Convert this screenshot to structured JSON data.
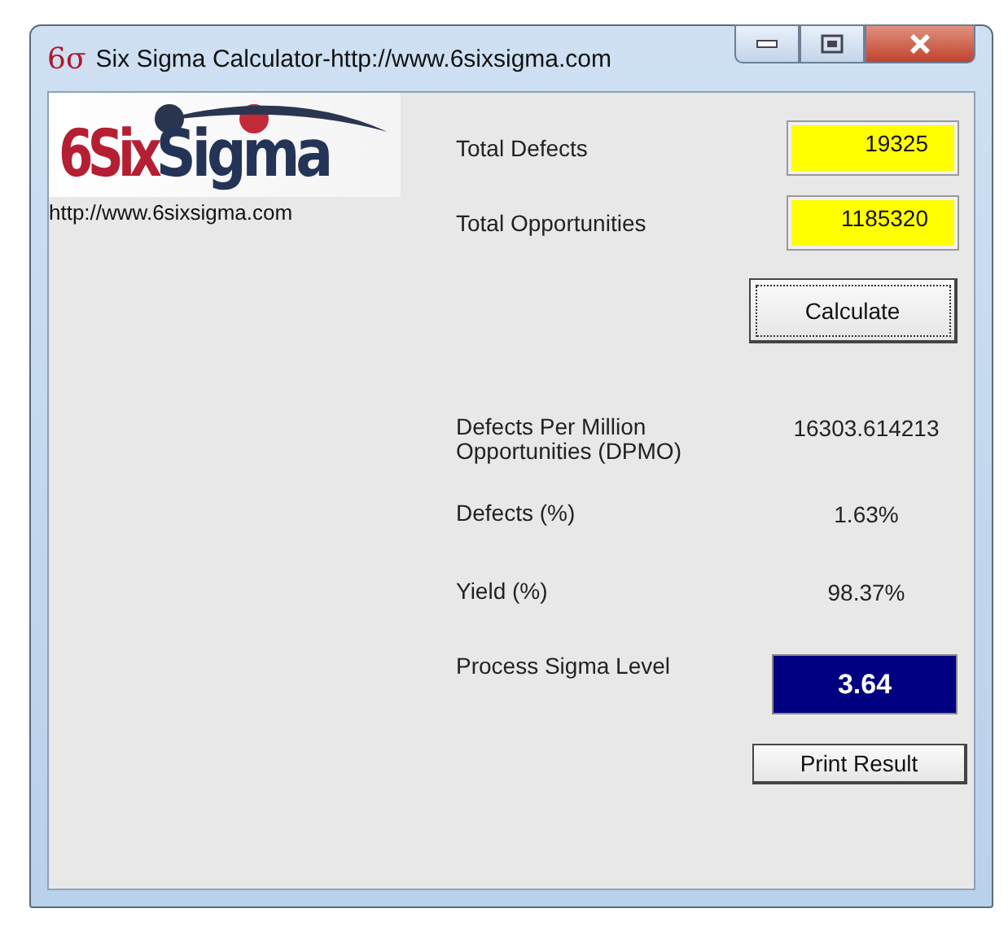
{
  "window": {
    "app_icon": "6σ",
    "title": "Six Sigma Calculator-http://www.6sixsigma.com"
  },
  "logo": {
    "red_part": "6Six",
    "navy_part": "Sigma"
  },
  "website": "http://www.6sixsigma.com",
  "inputs": [
    {
      "label": "Total Defects",
      "value": "19325"
    },
    {
      "label": "Total Opportunities",
      "value": "1185320"
    }
  ],
  "calculate_button": "Calculate",
  "results": [
    {
      "kind": "plain",
      "label": "Defects Per Million Opportunities (DPMO)",
      "value": "16303.614213"
    },
    {
      "kind": "plain",
      "label": "Defects (%)",
      "value": "1.63%"
    },
    {
      "kind": "plain",
      "label": "Yield (%)",
      "value": "98.37%"
    },
    {
      "kind": "highlight",
      "label": "Process Sigma Level",
      "value": "3.64"
    }
  ],
  "print_button": "Print Result"
}
